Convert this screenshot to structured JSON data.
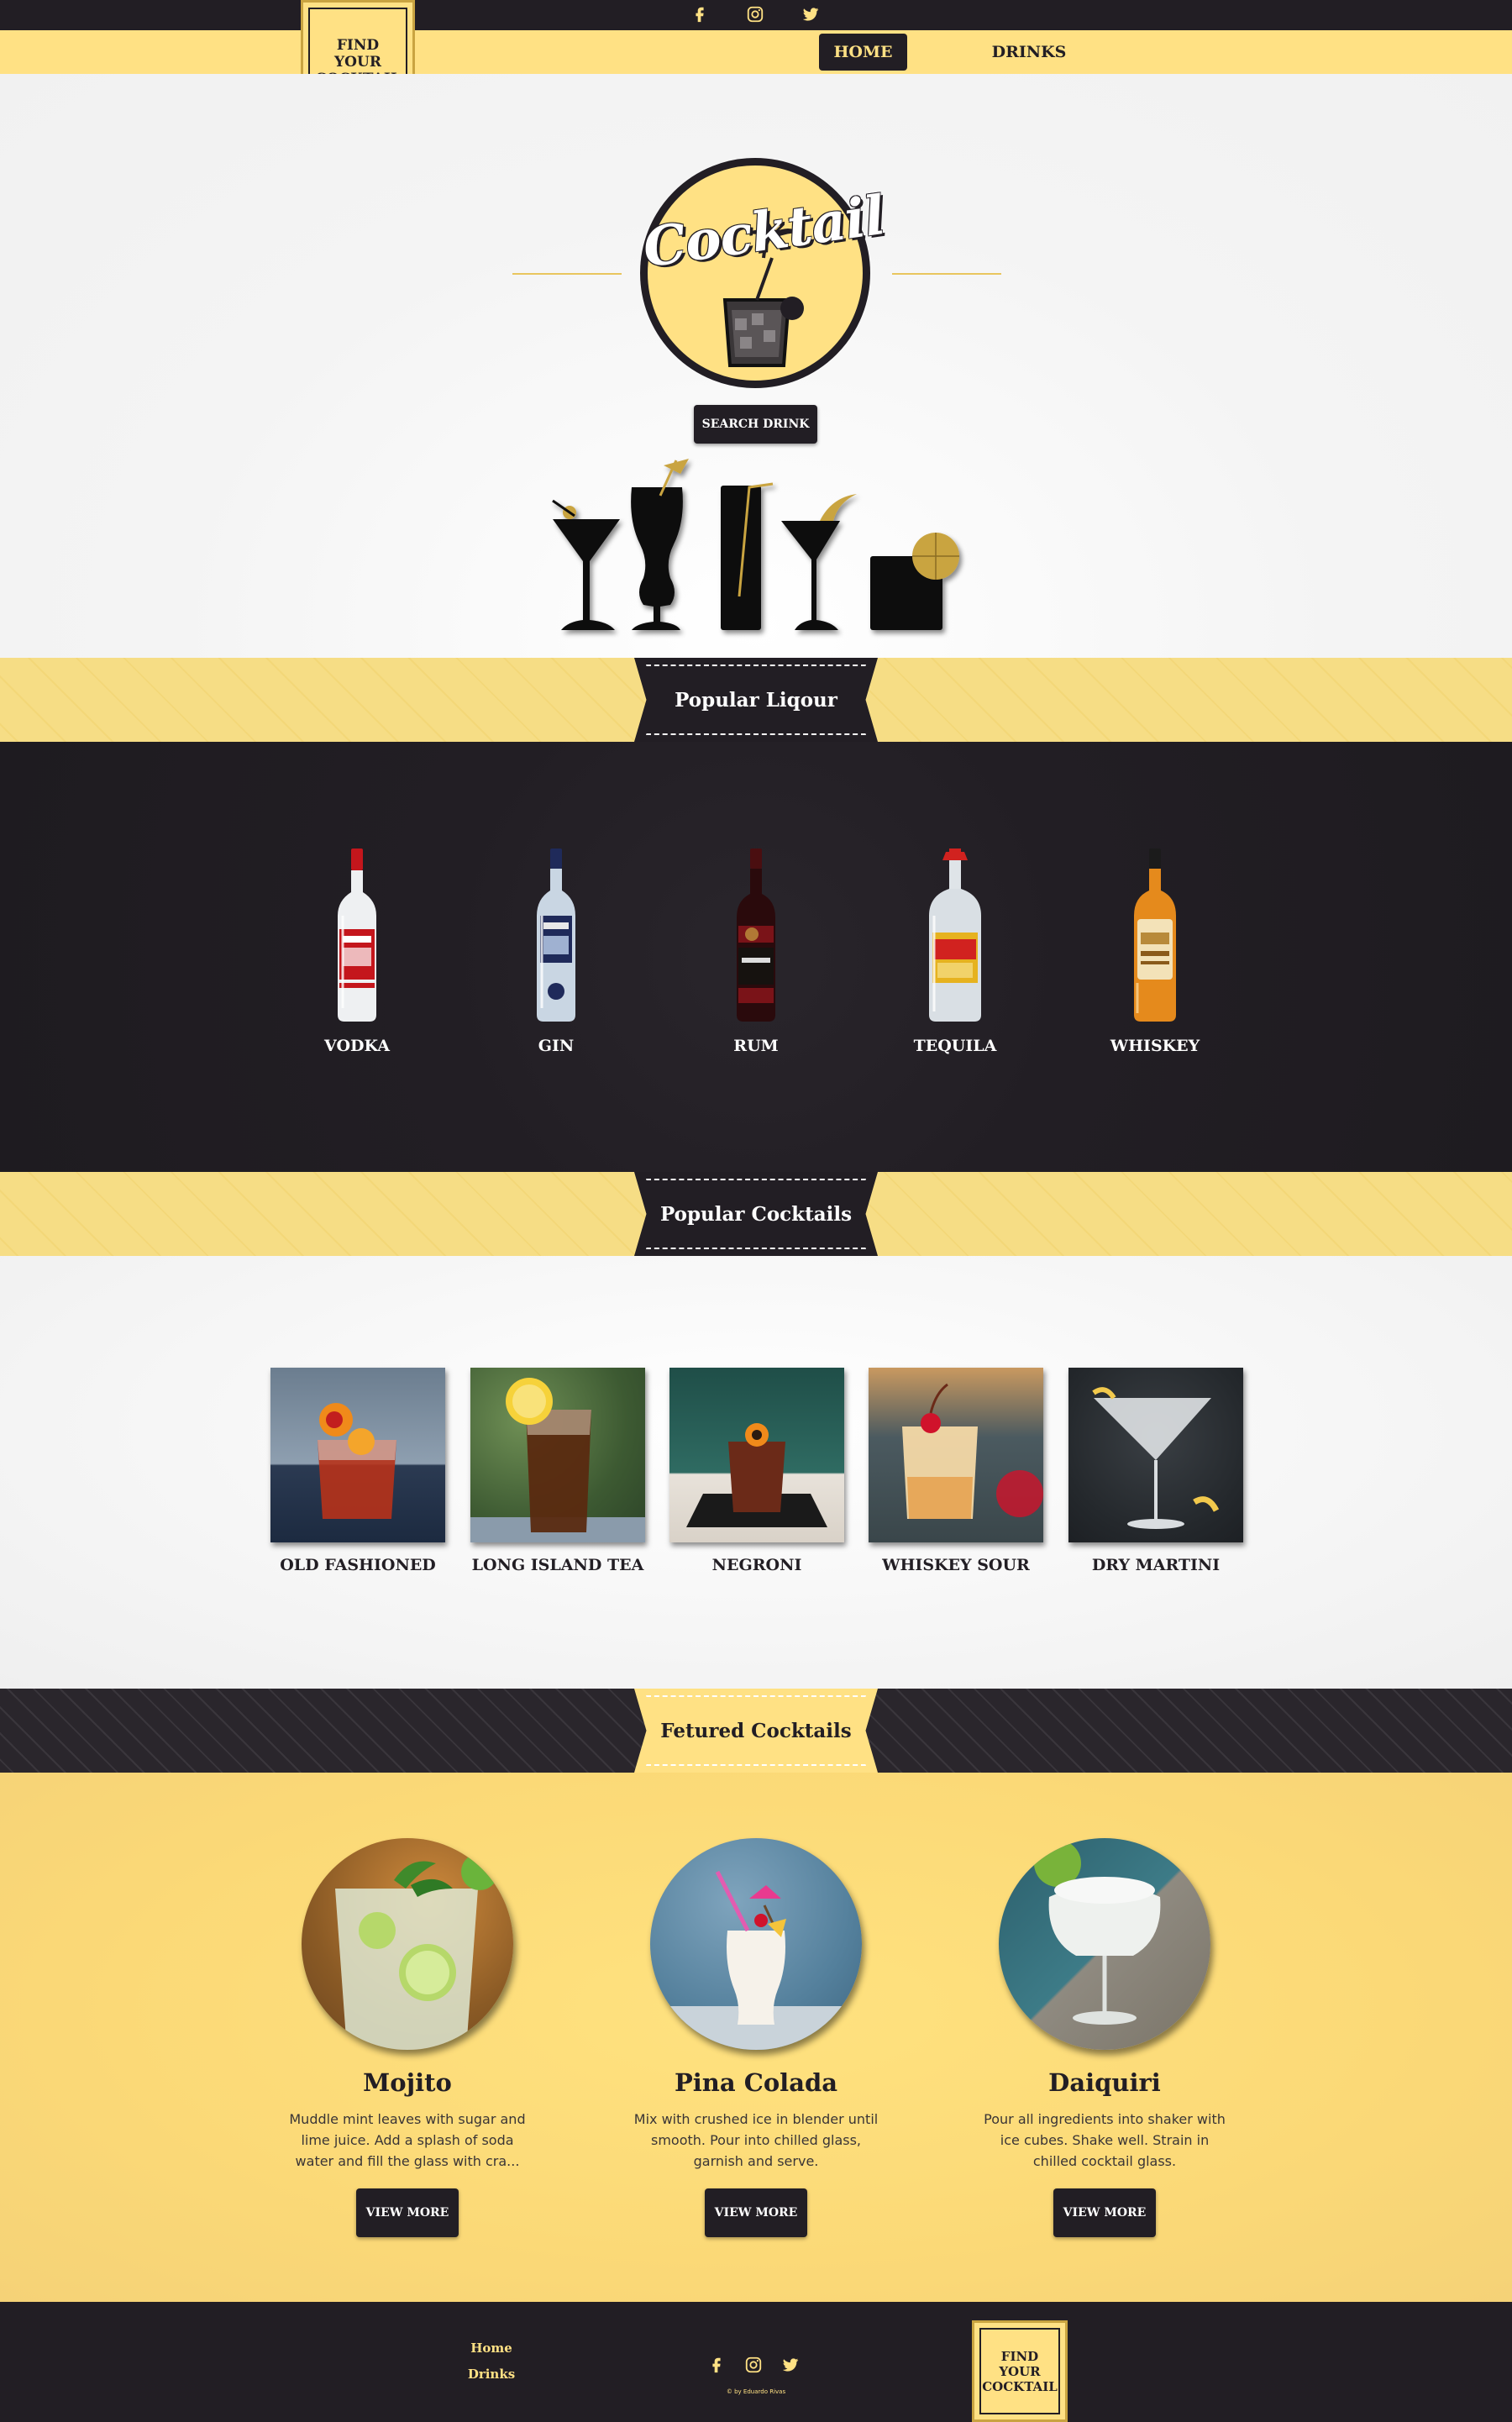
{
  "colors": {
    "dark": "#221e24",
    "yellow": "#ffe184",
    "gold": "#c9a441"
  },
  "header": {
    "social_icons": [
      "facebook-icon",
      "instagram-icon",
      "twitter-icon"
    ],
    "logo_text": "FIND\nYOUR\nCOCKTAIL",
    "nav": {
      "home_label": "HOME",
      "drinks_label": "DRINKS"
    }
  },
  "hero": {
    "badge_text": "Cocktail",
    "search_button_label": "SEARCH DRINK"
  },
  "liquor_section": {
    "title": "Popular Liqour",
    "items": [
      {
        "label": "VODKA"
      },
      {
        "label": "GIN"
      },
      {
        "label": "RUM"
      },
      {
        "label": "TEQUILA"
      },
      {
        "label": "WHISKEY"
      }
    ]
  },
  "cocktails_section": {
    "title": "Popular Cocktails",
    "items": [
      {
        "label": "OLD FASHIONED"
      },
      {
        "label": "LONG ISLAND TEA"
      },
      {
        "label": "NEGRONI"
      },
      {
        "label": "WHISKEY SOUR"
      },
      {
        "label": "DRY MARTINI"
      }
    ]
  },
  "featured_section": {
    "title": "Fetured Cocktails",
    "items": [
      {
        "title": "Mojito",
        "description": "Muddle mint leaves with sugar and lime juice. Add a splash of soda water and fill the glass with cra...",
        "button_label": "VIEW MORE"
      },
      {
        "title": "Pina Colada",
        "description": "Mix with crushed ice in blender until smooth. Pour into chilled glass, garnish and serve.",
        "button_label": "VIEW MORE"
      },
      {
        "title": "Daiquiri",
        "description": "Pour all ingredients into shaker with ice cubes. Shake well. Strain in chilled cocktail glass.",
        "button_label": "VIEW MORE"
      }
    ]
  },
  "footer": {
    "links": {
      "home": "Home",
      "drinks": "Drinks"
    },
    "credit": "© by Eduardo Rivas",
    "logo_text": "FIND\nYOUR\nCOCKTAIL"
  }
}
